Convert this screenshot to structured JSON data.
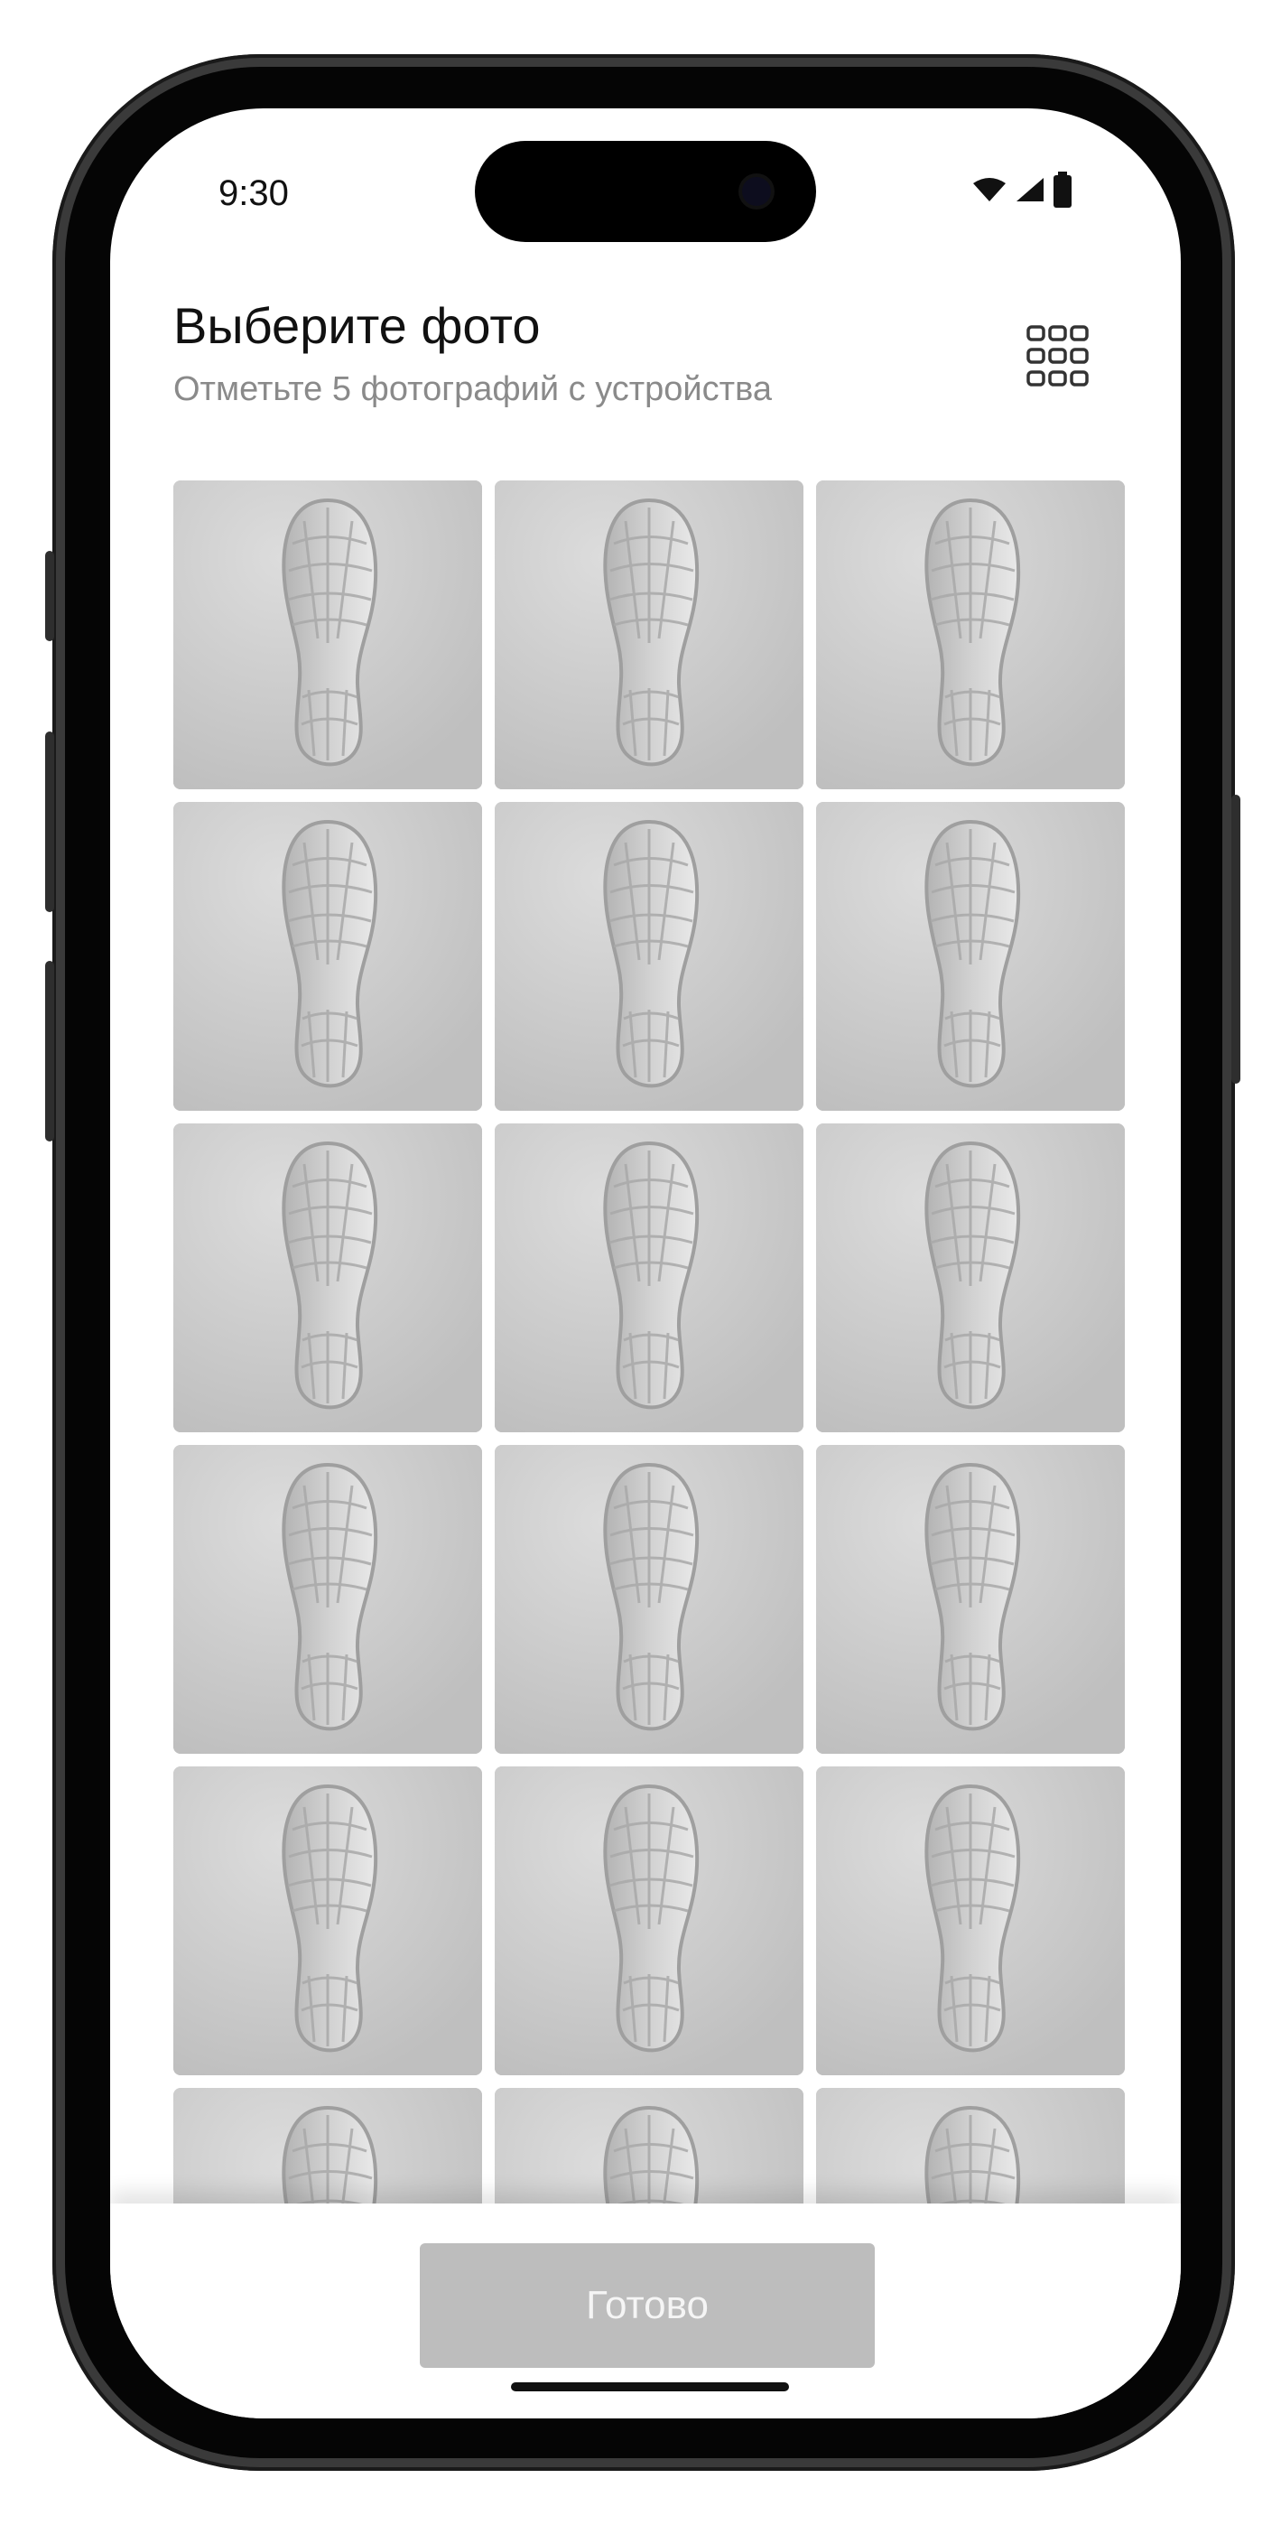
{
  "status_bar": {
    "time": "9:30",
    "icons": [
      "wifi-icon",
      "signal-icon",
      "battery-icon"
    ]
  },
  "header": {
    "title": "Выберите фото",
    "subtitle": "Отметьте 5 фотографий с устройства",
    "grid_toggle_icon": "grid-view-icon"
  },
  "photos": {
    "count": 18,
    "subject": "footprint-in-snow"
  },
  "footer": {
    "done_label": "Готово",
    "done_color": "#bdbdbd"
  }
}
